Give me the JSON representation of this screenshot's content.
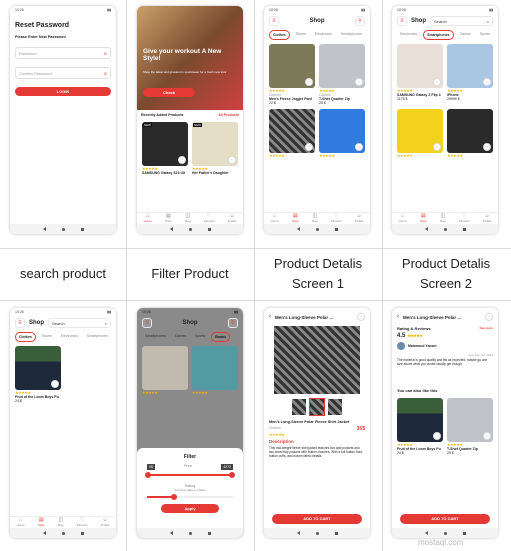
{
  "captions": [
    "search product",
    "Filter Product",
    "Product Detalis Screen 1",
    "Product Detalis Screen 2"
  ],
  "status_time": "10:26",
  "reset": {
    "title": "Reset Password",
    "subtitle": "Please Enter New Password",
    "password_placeholder": "Password",
    "confirm_placeholder": "Confirm Password",
    "login_label": "LOGIN"
  },
  "home": {
    "hero_title": "Give your workout A New Style!",
    "hero_text": "Shop the latest and greatest in sportswear for a fresh new look",
    "check_label": "Check",
    "recent_label": "Recently Added Products",
    "all_products": "All Products",
    "badge_new": "NEW",
    "products": [
      {
        "name": "SAMSUNG Galaxy S23 Ult",
        "price": ""
      },
      {
        "name": "Her Father's Daughter",
        "price": ""
      }
    ]
  },
  "shop": {
    "title": "Shop",
    "chips": [
      "Clothes",
      "Shoes",
      "Electronics",
      "Smartphones"
    ],
    "products": [
      {
        "category": "Clothes",
        "name": "Men's Fleece Jogger Pant",
        "price": "22 $"
      },
      {
        "category": "Clothes",
        "name": "T-Shirt Quarter Zip",
        "price": "25 $"
      }
    ]
  },
  "search_phones": {
    "title": "Shop",
    "query": "Search",
    "chips": [
      "Electronics",
      "Smartphones",
      "Games",
      "Sports"
    ],
    "products": [
      {
        "name": "SAMSUNG Galaxy Z Flip 4",
        "price": "1175 $"
      },
      {
        "name": "iPhone",
        "price": "29999 $"
      }
    ]
  },
  "search_hoodie": {
    "title": "Shop",
    "query": "Search",
    "chips": [
      "Clothes",
      "Shoes",
      "Electronics",
      "Smartphones"
    ],
    "product": {
      "name": "Fruit of the Loom Boys Pu",
      "price": "24 $"
    }
  },
  "filter": {
    "title": "Shop",
    "chips": [
      "Smartphones",
      "Games",
      "Sports",
      "Books"
    ],
    "sheet_title": "Filter",
    "price_label": "Price",
    "min_price": "0$",
    "max_price": "4272",
    "rating_label": "Rating",
    "rating_hint": "Products above 2 Stars",
    "apply_label": "Apply"
  },
  "detail1": {
    "title": "Men's Long-Sleeve Polar ...",
    "product_name": "Men's Long-Sleeve Polar Fleece Shirt Jacket",
    "category": "Clothes",
    "price": "35$",
    "description_label": "Description",
    "description": "This mid-weight fleece shirt jacket features two wall pockets and two chest flap pockets with button closures. With a full button front, button cuffs, and woven fabric details.",
    "add_to_cart": "ADD TO CART"
  },
  "detail2": {
    "title": "Men's Long-Sleeve Polar ...",
    "rating_title": "Rating & Reviews",
    "see_more": "See more",
    "rating_value": "4.5",
    "reviewer": "Mahmoud Yasser",
    "review_date": "Tue, Dec 20, 2022",
    "review_text": "The material is good quality and fits as expected, maybe go one size above what you would usually get though.",
    "also_like": "You can also like this",
    "products": [
      {
        "name": "Fruit of the Loom Boys Pu",
        "price": "24 $"
      },
      {
        "name": "T-Shirt Quarter Zip",
        "price": "25 $"
      }
    ],
    "add_to_cart": "ADD TO CART"
  },
  "bottom_tabs": [
    "Home",
    "Shop",
    "Bag",
    "Favorite",
    "Profile"
  ],
  "watermark": "mostaql.com"
}
